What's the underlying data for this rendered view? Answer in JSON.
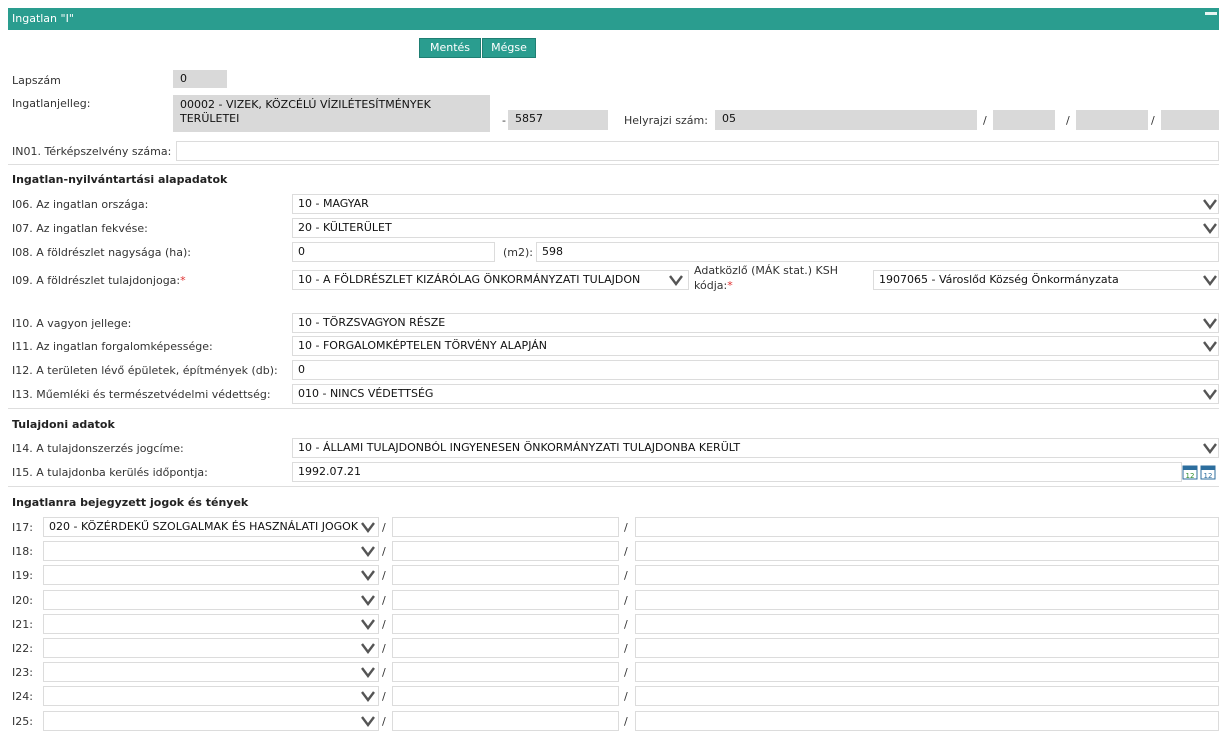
{
  "window": {
    "title": "Ingatlan \"I\""
  },
  "toolbar": {
    "save_label": "Mentés",
    "cancel_label": "Mégse"
  },
  "header": {
    "lapszam_label": "Lapszám",
    "lapszam_value": "0",
    "jelleg_label": "Ingatlanjelleg:",
    "jelleg_value_line1": "00002 - VIZEK, KÖZCÉLÚ VÍZILÉTESÍTMÉNYEK",
    "jelleg_value_line2": "TERÜLETEI",
    "dash": "-",
    "jelleg_code": "5857",
    "hrsz_label": "Helyrajzi szám:",
    "hrsz_value": "05",
    "in01_label": "IN01. Térképszelvény száma:",
    "in01_value": ""
  },
  "section1": {
    "title": "Ingatlan-nyilvántartási alapadatok",
    "i06_label": "I06. Az ingatlan országa:",
    "i06_value": "10 - MAGYAR",
    "i07_label": "I07. Az ingatlan fekvése:",
    "i07_value": "20 - KÜLTERÜLET",
    "i08_label": "I08. A földrészlet nagysága (ha):",
    "i08_value": "0",
    "m2_label": "(m2):",
    "m2_value": "598",
    "i09_label": "I09. A földrészlet tulajdonjoga:",
    "i09_req": "*",
    "i09_value": "10 - A FÖLDRÉSZLET KIZÁRÓLAG ÖNKORMÁNYZATI TULAJDON",
    "ksh_label_line1": "Adatközlő (MÁK stat.) KSH",
    "ksh_label_line2": "kódja:",
    "ksh_req": "*",
    "ksh_value": "1907065 - Városlőd Község Önkormányzata",
    "i10_label": "I10. A vagyon jellege:",
    "i10_value": "10 - TÖRZSVAGYON RÉSZE",
    "i11_label": "I11. Az ingatlan forgalomképessége:",
    "i11_value": "10 - FORGALOMKÉPTELEN TÖRVÉNY ALAPJÁN",
    "i12_label": "I12. A területen lévő épületek, építmények (db):",
    "i12_value": "0",
    "i13_label": "I13. Műemléki és természetvédelmi védettség:",
    "i13_value": "010 - NINCS VÉDETTSÉG"
  },
  "section2": {
    "title": "Tulajdoni adatok",
    "i14_label": "I14. A tulajdonszerzés jogcíme:",
    "i14_value": "10 - ÁLLAMI TULAJDONBÓL INGYENESEN ÖNKORMÁNYZATI TULAJDONBA KERÜLT",
    "i15_label": "I15. A tulajdonba kerülés időpontja:",
    "i15_value": "1992.07.21",
    "cal_day": "12"
  },
  "section3": {
    "title": "Ingatlanra bejegyzett jogok és tények",
    "rows": [
      {
        "label": "I17:",
        "value": "020 - KÖZÉRDEKŰ SZOLGALMAK ÉS HASZNÁLATI JOGOK"
      },
      {
        "label": "I18:",
        "value": ""
      },
      {
        "label": "I19:",
        "value": ""
      },
      {
        "label": "I20:",
        "value": ""
      },
      {
        "label": "I21:",
        "value": ""
      },
      {
        "label": "I22:",
        "value": ""
      },
      {
        "label": "I23:",
        "value": ""
      },
      {
        "label": "I24:",
        "value": ""
      },
      {
        "label": "I25:",
        "value": ""
      }
    ]
  },
  "separator": "/",
  "colors": {
    "accent": "#2a9d8f",
    "readonly": "#d9d9d9",
    "required": "#e03030"
  },
  "icons": {
    "dropdown": "chevron-down-icon",
    "calendar": "calendar-icon"
  }
}
